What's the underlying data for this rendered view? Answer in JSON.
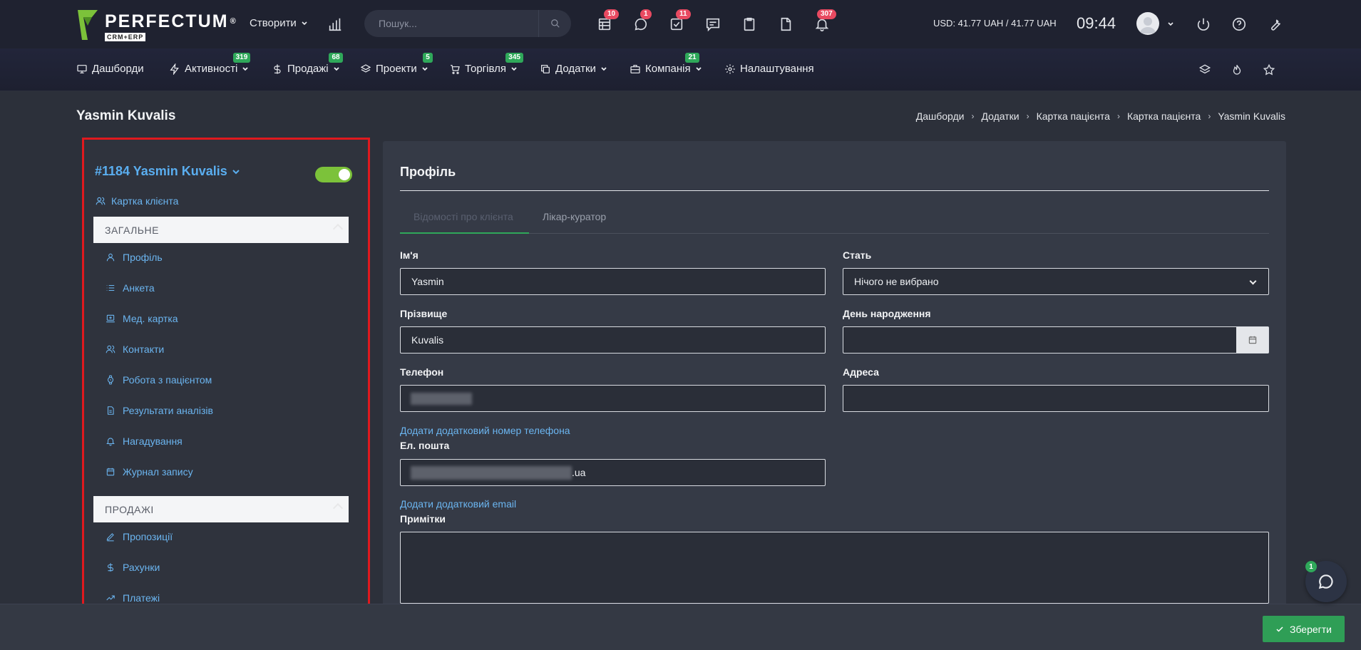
{
  "app": {
    "logo_text": "PERFECTUM",
    "logo_reg": "®",
    "logo_sub": "CRM+ERP"
  },
  "topbar": {
    "create_label": "Створити",
    "search_placeholder": "Пошук...",
    "badges": {
      "calendar": "10",
      "chat": "1",
      "tasks": "11",
      "notifications": "307"
    },
    "currency": "USD: 41.77 UAH / 41.77 UAH",
    "time": "09:44"
  },
  "nav": {
    "items": [
      {
        "label": "Дашборди",
        "badge": ""
      },
      {
        "label": "Активності",
        "badge": "319"
      },
      {
        "label": "Продажі",
        "badge": "68"
      },
      {
        "label": "Проекти",
        "badge": "5"
      },
      {
        "label": "Торгівля",
        "badge": "345"
      },
      {
        "label": "Додатки",
        "badge": ""
      },
      {
        "label": "Компанія",
        "badge": "21"
      },
      {
        "label": "Налаштування",
        "badge": ""
      }
    ]
  },
  "page": {
    "title": "Yasmin Kuvalis",
    "breadcrumb": [
      "Дашборди",
      "Додатки",
      "Картка пацієнта",
      "Картка пацієнта",
      "Yasmin Kuvalis"
    ]
  },
  "sidebar": {
    "patient": "#1184 Yasmin Kuvalis",
    "active": true,
    "client_card_link": "Картка клієнта",
    "sections": [
      {
        "title": "ЗАГАЛЬНЕ",
        "items": [
          "Профіль",
          "Анкета",
          "Мед. картка",
          "Контакти",
          "Робота з пацієнтом",
          "Результати аналізів",
          "Нагадування",
          "Журнал запису"
        ]
      },
      {
        "title": "ПРОДАЖІ",
        "items": [
          "Пропозиції",
          "Рахунки",
          "Платежі"
        ]
      }
    ]
  },
  "profile": {
    "title": "Профіль",
    "tabs": [
      "Відомості про клієнта",
      "Лікар-куратор"
    ],
    "fields": {
      "first_name_label": "Ім'я",
      "first_name_value": "Yasmin",
      "gender_label": "Стать",
      "gender_value": "Нічого не вибрано",
      "last_name_label": "Прізвище",
      "last_name_value": "Kuvalis",
      "birthday_label": "День народження",
      "birthday_value": "",
      "phone_label": "Телефон",
      "address_label": "Адреса",
      "address_value": "",
      "add_phone_link": "Додати додатковий номер телефона",
      "email_label": "Ел. пошта",
      "email_visible_suffix": ".ua",
      "add_email_link": "Додати додатковий email",
      "notes_label": "Примітки",
      "notes_value": ""
    },
    "save_label": "Зберегти"
  },
  "chat_widget": {
    "badge": "1"
  },
  "colors": {
    "accent_green": "#2fa85a",
    "link_blue": "#6bb5f0",
    "badge_red": "#e84a61",
    "highlight_red": "#e0191e",
    "toggle_green": "#7cc23a"
  }
}
